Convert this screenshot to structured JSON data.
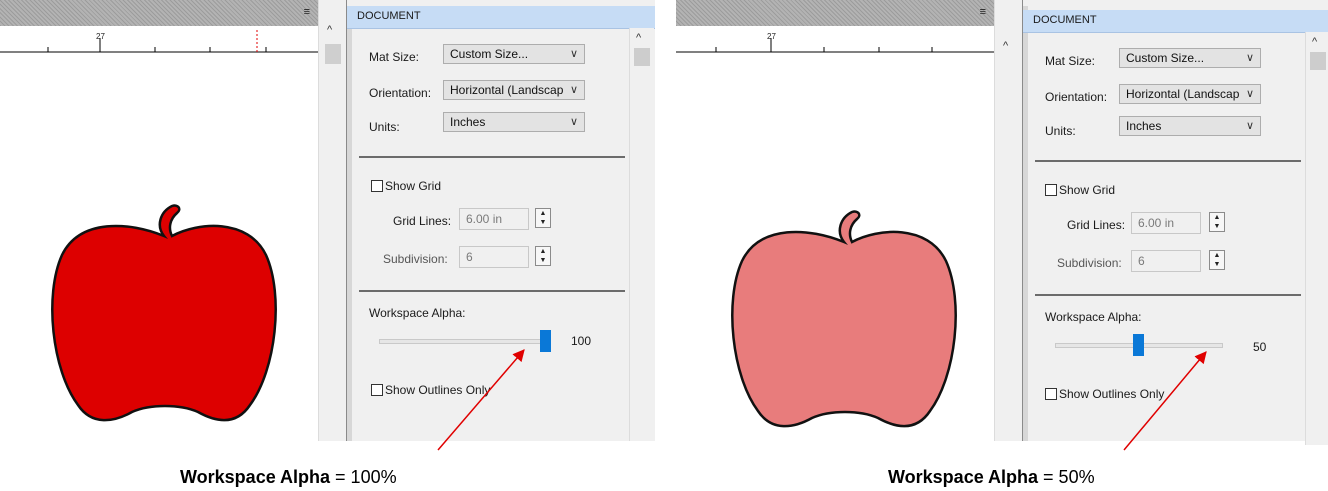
{
  "panels": [
    {
      "panel_title": "DOCUMENT",
      "ruler_label": "27",
      "menu_icon": "≡",
      "mat_size": {
        "label": "Mat Size:",
        "value": "Custom Size..."
      },
      "orientation": {
        "label": "Orientation:",
        "value": "Horizontal (Landscap"
      },
      "units": {
        "label": "Units:",
        "value": "Inches"
      },
      "show_grid": {
        "label": "Show Grid",
        "checked": false
      },
      "grid_lines": {
        "label": "Grid Lines:",
        "value": "6.00 in"
      },
      "subdivision": {
        "label": "Subdivision:",
        "value": "6"
      },
      "workspace_alpha": {
        "label": "Workspace Alpha:",
        "value": "100",
        "level": 1.0
      },
      "show_outlines": {
        "label": "Show Outlines Only",
        "checked": false
      },
      "apple_fill": "#dd0000"
    },
    {
      "panel_title": "DOCUMENT",
      "ruler_label": "27",
      "menu_icon": "≡",
      "mat_size": {
        "label": "Mat Size:",
        "value": "Custom Size..."
      },
      "orientation": {
        "label": "Orientation:",
        "value": "Horizontal (Landscap"
      },
      "units": {
        "label": "Units:",
        "value": "Inches"
      },
      "show_grid": {
        "label": "Show Grid",
        "checked": false
      },
      "grid_lines": {
        "label": "Grid Lines:",
        "value": "6.00 in"
      },
      "subdivision": {
        "label": "Subdivision:",
        "value": "6"
      },
      "workspace_alpha": {
        "label": "Workspace Alpha:",
        "value": "50",
        "level": 0.5
      },
      "show_outlines": {
        "label": "Show Outlines Only",
        "checked": false
      },
      "apple_fill": "#e87c7c"
    }
  ],
  "captions": [
    {
      "bold": "Workspace Alpha",
      "rest": " = 100%"
    },
    {
      "bold": "Workspace Alpha",
      "rest": " = 50%"
    }
  ],
  "colors": {
    "accent": "#0a78d7",
    "annotation_arrow": "#e00000",
    "header": "#c6dcf5"
  }
}
